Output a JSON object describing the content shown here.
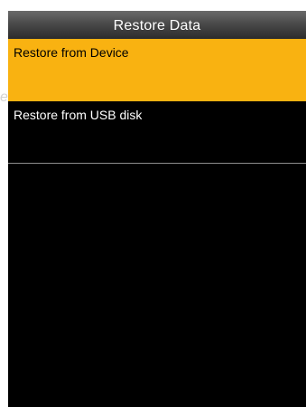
{
  "header": {
    "title": "Restore Data"
  },
  "menu": {
    "items": [
      {
        "label": "Restore from Device",
        "selected": true
      },
      {
        "label": "Restore from USB disk",
        "selected": false
      }
    ]
  },
  "colors": {
    "selected_bg": "#f9b211",
    "screen_bg": "#000000",
    "divider": "#8d8d8d"
  }
}
